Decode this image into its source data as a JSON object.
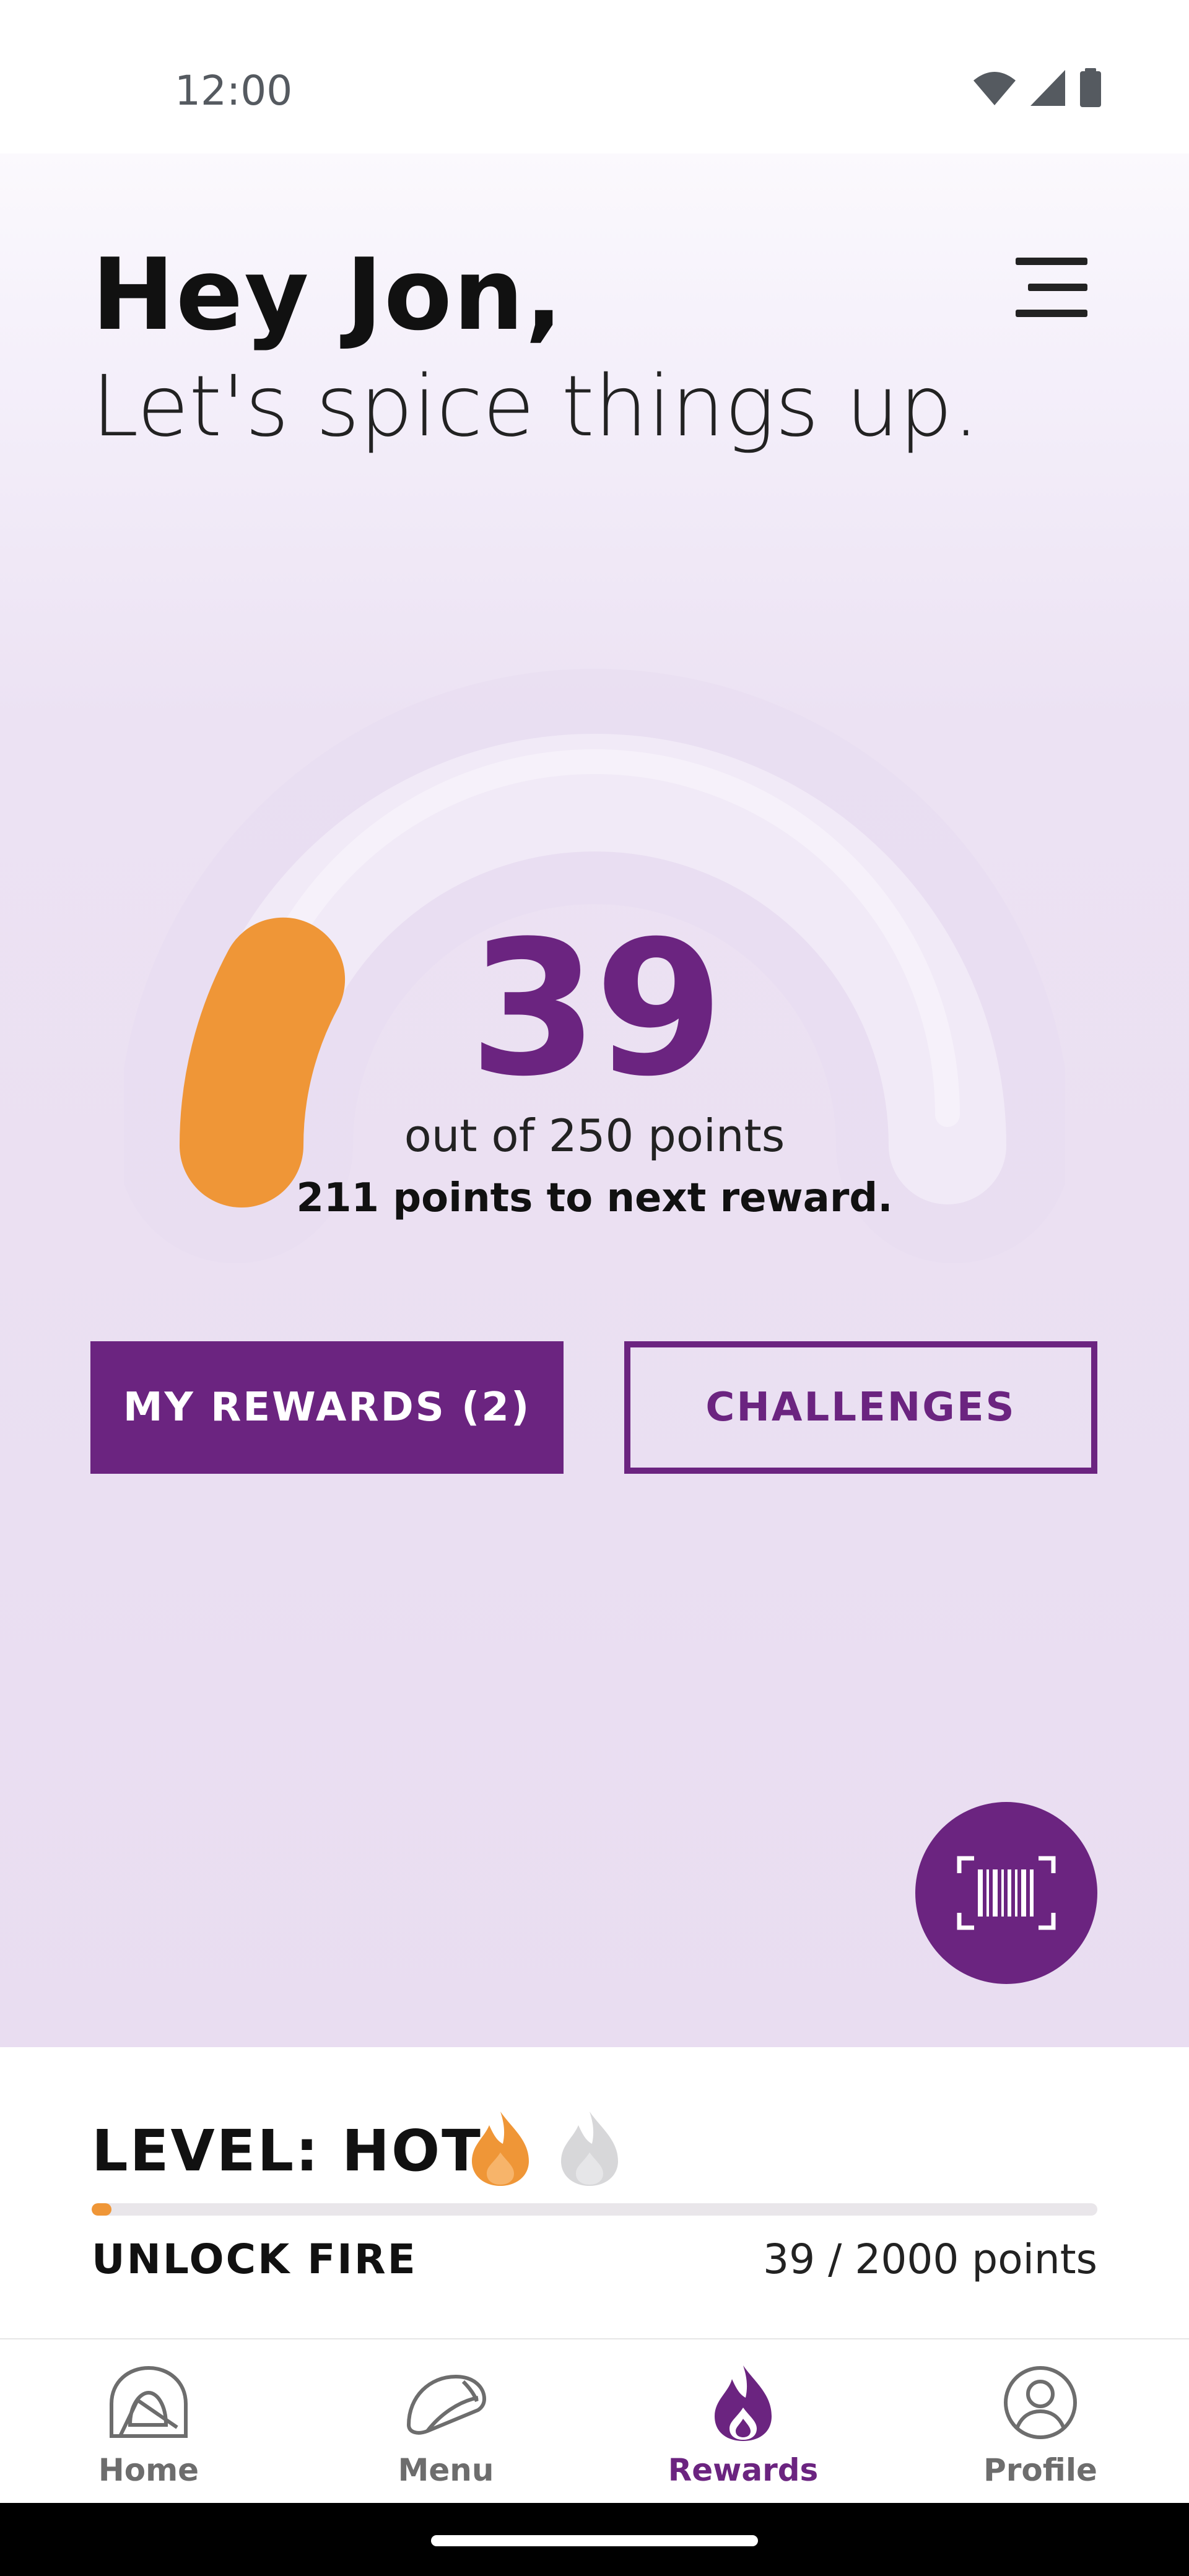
{
  "status_bar": {
    "time": "12:00",
    "icons": [
      "wifi-icon",
      "cell-signal-icon",
      "battery-icon"
    ]
  },
  "header": {
    "greeting": "Hey Jon,",
    "tagline": "Let's spice things up.",
    "menu_icon": "hamburger-menu-icon"
  },
  "points": {
    "current": "39",
    "out_of": "out of 250 points",
    "to_next": "211 points to next reward.",
    "progress_fraction": 0.156
  },
  "actions": {
    "my_rewards": "MY REWARDS (2)",
    "challenges": "CHALLENGES"
  },
  "fab": {
    "icon": "barcode-scan-icon"
  },
  "level": {
    "title": "LEVEL: HOT",
    "unlock_label": "UNLOCK FIRE",
    "points_text": "39 / 2000 points",
    "progress_fraction": 0.0195,
    "flames": [
      "flame-hot-icon",
      "flame-fire-icon"
    ]
  },
  "nav": {
    "items": [
      {
        "label": "Home",
        "icon": "home-bell-icon"
      },
      {
        "label": "Menu",
        "icon": "taco-icon"
      },
      {
        "label": "Rewards",
        "icon": "flame-icon"
      },
      {
        "label": "Profile",
        "icon": "profile-icon"
      }
    ]
  },
  "colors": {
    "brand_purple": "#6b2480",
    "accent_orange": "#ef9637",
    "background_lavender": "#e9ddf1"
  }
}
